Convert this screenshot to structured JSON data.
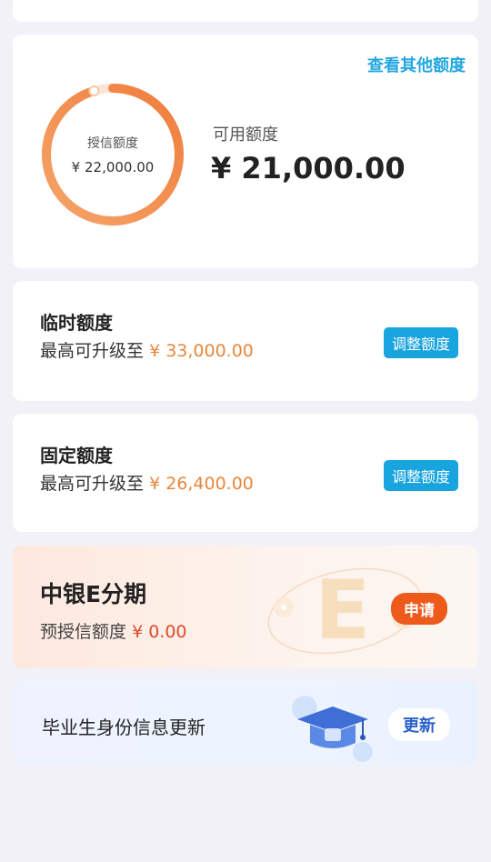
{
  "credit": {
    "other_link": "查看其他额度",
    "granted_label": "授信额度",
    "granted_value": "¥ 22,000.00",
    "available_label": "可用额度",
    "available_value": "¥ 21,000.00",
    "available_ratio": 0.9545,
    "ring_color": "#f2874a"
  },
  "temp_limit": {
    "title": "临时额度",
    "sub_prefix": "最高可升级至",
    "amount": "¥ 33,000.00",
    "button": "调整额度"
  },
  "fixed_limit": {
    "title": "固定额度",
    "sub_prefix": "最高可升级至",
    "amount": "¥ 26,400.00",
    "button": "调整额度"
  },
  "installment": {
    "title": "中银E分期",
    "sub_prefix": "预授信额度",
    "amount": "¥ 0.00",
    "button": "申请",
    "decor_letter": "E"
  },
  "graduate": {
    "title": "毕业生身份信息更新",
    "button": "更新"
  },
  "colors": {
    "accent_blue": "#18a4de",
    "amount_orange": "#e8873a",
    "apply_orange": "#ee5a1c",
    "background": "#f1f1f7"
  }
}
